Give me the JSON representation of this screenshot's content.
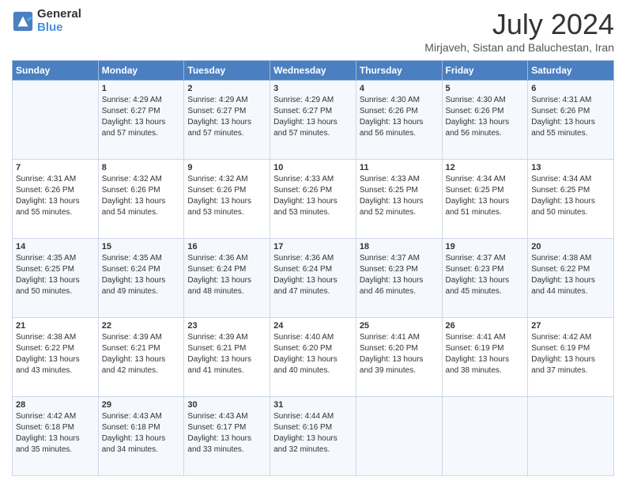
{
  "header": {
    "logo_line1": "General",
    "logo_line2": "Blue",
    "title": "July 2024",
    "subtitle": "Mirjaveh, Sistan and Baluchestan, Iran"
  },
  "days_of_week": [
    "Sunday",
    "Monday",
    "Tuesday",
    "Wednesday",
    "Thursday",
    "Friday",
    "Saturday"
  ],
  "weeks": [
    [
      {
        "day": "",
        "info": ""
      },
      {
        "day": "1",
        "info": "Sunrise: 4:29 AM\nSunset: 6:27 PM\nDaylight: 13 hours\nand 57 minutes."
      },
      {
        "day": "2",
        "info": "Sunrise: 4:29 AM\nSunset: 6:27 PM\nDaylight: 13 hours\nand 57 minutes."
      },
      {
        "day": "3",
        "info": "Sunrise: 4:29 AM\nSunset: 6:27 PM\nDaylight: 13 hours\nand 57 minutes."
      },
      {
        "day": "4",
        "info": "Sunrise: 4:30 AM\nSunset: 6:26 PM\nDaylight: 13 hours\nand 56 minutes."
      },
      {
        "day": "5",
        "info": "Sunrise: 4:30 AM\nSunset: 6:26 PM\nDaylight: 13 hours\nand 56 minutes."
      },
      {
        "day": "6",
        "info": "Sunrise: 4:31 AM\nSunset: 6:26 PM\nDaylight: 13 hours\nand 55 minutes."
      }
    ],
    [
      {
        "day": "7",
        "info": "Sunrise: 4:31 AM\nSunset: 6:26 PM\nDaylight: 13 hours\nand 55 minutes."
      },
      {
        "day": "8",
        "info": "Sunrise: 4:32 AM\nSunset: 6:26 PM\nDaylight: 13 hours\nand 54 minutes."
      },
      {
        "day": "9",
        "info": "Sunrise: 4:32 AM\nSunset: 6:26 PM\nDaylight: 13 hours\nand 53 minutes."
      },
      {
        "day": "10",
        "info": "Sunrise: 4:33 AM\nSunset: 6:26 PM\nDaylight: 13 hours\nand 53 minutes."
      },
      {
        "day": "11",
        "info": "Sunrise: 4:33 AM\nSunset: 6:25 PM\nDaylight: 13 hours\nand 52 minutes."
      },
      {
        "day": "12",
        "info": "Sunrise: 4:34 AM\nSunset: 6:25 PM\nDaylight: 13 hours\nand 51 minutes."
      },
      {
        "day": "13",
        "info": "Sunrise: 4:34 AM\nSunset: 6:25 PM\nDaylight: 13 hours\nand 50 minutes."
      }
    ],
    [
      {
        "day": "14",
        "info": "Sunrise: 4:35 AM\nSunset: 6:25 PM\nDaylight: 13 hours\nand 50 minutes."
      },
      {
        "day": "15",
        "info": "Sunrise: 4:35 AM\nSunset: 6:24 PM\nDaylight: 13 hours\nand 49 minutes."
      },
      {
        "day": "16",
        "info": "Sunrise: 4:36 AM\nSunset: 6:24 PM\nDaylight: 13 hours\nand 48 minutes."
      },
      {
        "day": "17",
        "info": "Sunrise: 4:36 AM\nSunset: 6:24 PM\nDaylight: 13 hours\nand 47 minutes."
      },
      {
        "day": "18",
        "info": "Sunrise: 4:37 AM\nSunset: 6:23 PM\nDaylight: 13 hours\nand 46 minutes."
      },
      {
        "day": "19",
        "info": "Sunrise: 4:37 AM\nSunset: 6:23 PM\nDaylight: 13 hours\nand 45 minutes."
      },
      {
        "day": "20",
        "info": "Sunrise: 4:38 AM\nSunset: 6:22 PM\nDaylight: 13 hours\nand 44 minutes."
      }
    ],
    [
      {
        "day": "21",
        "info": "Sunrise: 4:38 AM\nSunset: 6:22 PM\nDaylight: 13 hours\nand 43 minutes."
      },
      {
        "day": "22",
        "info": "Sunrise: 4:39 AM\nSunset: 6:21 PM\nDaylight: 13 hours\nand 42 minutes."
      },
      {
        "day": "23",
        "info": "Sunrise: 4:39 AM\nSunset: 6:21 PM\nDaylight: 13 hours\nand 41 minutes."
      },
      {
        "day": "24",
        "info": "Sunrise: 4:40 AM\nSunset: 6:20 PM\nDaylight: 13 hours\nand 40 minutes."
      },
      {
        "day": "25",
        "info": "Sunrise: 4:41 AM\nSunset: 6:20 PM\nDaylight: 13 hours\nand 39 minutes."
      },
      {
        "day": "26",
        "info": "Sunrise: 4:41 AM\nSunset: 6:19 PM\nDaylight: 13 hours\nand 38 minutes."
      },
      {
        "day": "27",
        "info": "Sunrise: 4:42 AM\nSunset: 6:19 PM\nDaylight: 13 hours\nand 37 minutes."
      }
    ],
    [
      {
        "day": "28",
        "info": "Sunrise: 4:42 AM\nSunset: 6:18 PM\nDaylight: 13 hours\nand 35 minutes."
      },
      {
        "day": "29",
        "info": "Sunrise: 4:43 AM\nSunset: 6:18 PM\nDaylight: 13 hours\nand 34 minutes."
      },
      {
        "day": "30",
        "info": "Sunrise: 4:43 AM\nSunset: 6:17 PM\nDaylight: 13 hours\nand 33 minutes."
      },
      {
        "day": "31",
        "info": "Sunrise: 4:44 AM\nSunset: 6:16 PM\nDaylight: 13 hours\nand 32 minutes."
      },
      {
        "day": "",
        "info": ""
      },
      {
        "day": "",
        "info": ""
      },
      {
        "day": "",
        "info": ""
      }
    ]
  ]
}
